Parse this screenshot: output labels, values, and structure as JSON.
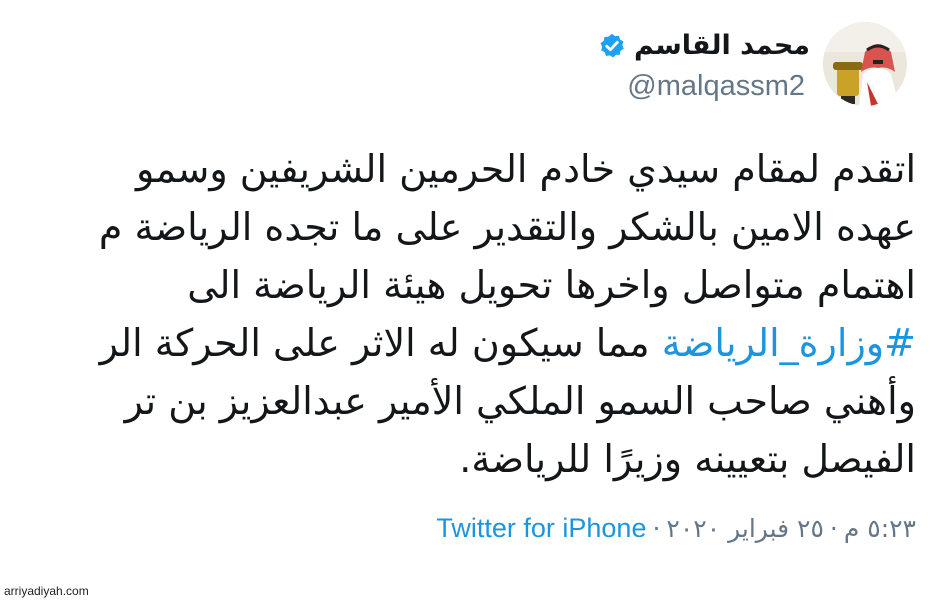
{
  "tweet": {
    "author": {
      "display_name": "محمد القاسم",
      "handle": "@malqassm2",
      "verified": true
    },
    "body_lines": [
      {
        "parts": [
          {
            "text": "اتقدم لمقام سيدي خادم الحرمين الشريفين وسمو",
            "hashtag": false
          }
        ]
      },
      {
        "parts": [
          {
            "text": "عهده الامين بالشكر والتقدير على ما تجده الرياضة م",
            "hashtag": false
          }
        ]
      },
      {
        "parts": [
          {
            "text": "اهتمام متواصل واخرها تحويل هيئة الرياضة الى",
            "hashtag": false
          }
        ]
      },
      {
        "parts": [
          {
            "text": "#وزارة_الرياضة",
            "hashtag": true
          },
          {
            "text": " مما سيكون له الاثر  على الحركة الر",
            "hashtag": false
          }
        ]
      },
      {
        "parts": [
          {
            "text": "وأهني صاحب السمو الملكي الأمير عبدالعزيز بن تر",
            "hashtag": false
          }
        ]
      },
      {
        "parts": [
          {
            "text": "الفيصل بتعيينه وزيرًا للرياضة.",
            "hashtag": false
          }
        ]
      }
    ],
    "meta": {
      "time": "٥:٢٣ م",
      "separator": "·",
      "date": "٢٥ فبراير ٢٠٢٠",
      "source": "Twitter for iPhone"
    }
  },
  "colors": {
    "link": "#1b95e0",
    "text": "#14171a",
    "secondary": "#657786",
    "verified": "#1da1f2"
  },
  "watermark": "arriyadiyah.com"
}
